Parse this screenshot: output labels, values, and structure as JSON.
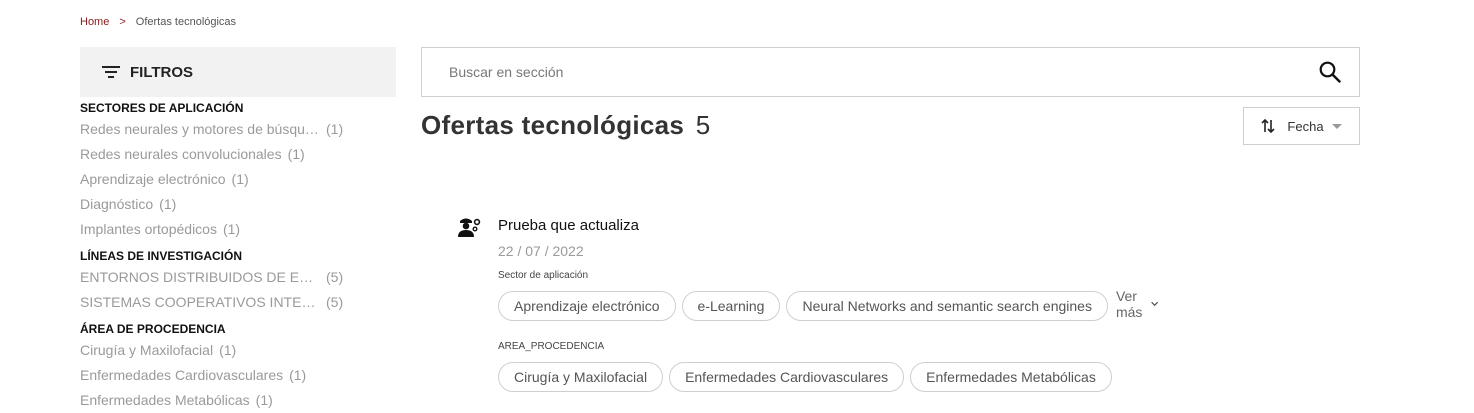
{
  "breadcrumb": {
    "home": "Home",
    "separator": ">",
    "current": "Ofertas tecnológicas"
  },
  "filters": {
    "title": "FILTROS",
    "icon": "filter-icon",
    "sections": [
      {
        "heading": "SECTORES DE APLICACIÓN",
        "items": [
          {
            "label": "Redes neurales y motores de búsqueda semántica",
            "count": "(1)"
          },
          {
            "label": "Redes neurales convolucionales",
            "count": "(1)"
          },
          {
            "label": "Aprendizaje electrónico",
            "count": "(1)"
          },
          {
            "label": "Diagnóstico",
            "count": "(1)"
          },
          {
            "label": "Implantes ortopédicos",
            "count": "(1)"
          }
        ]
      },
      {
        "heading": "LÍNEAS DE INVESTIGACIÓN",
        "items": [
          {
            "label": "ENTORNOS DISTRIBUIDOS DE ENSEÑANZA",
            "count": "(5)"
          },
          {
            "label": "SISTEMAS COOPERATIVOS INTELIGENTES",
            "count": "(5)"
          }
        ]
      },
      {
        "heading": "ÁREA DE PROCEDENCIA",
        "items": [
          {
            "label": "Cirugía y Maxilofacial",
            "count": "(1)"
          },
          {
            "label": "Enfermedades Cardiovasculares",
            "count": "(1)"
          },
          {
            "label": "Enfermedades Metabólicas",
            "count": "(1)"
          }
        ]
      }
    ]
  },
  "search": {
    "placeholder": "Buscar en sección",
    "value": ""
  },
  "page": {
    "title": "Ofertas tecnológicas",
    "count": "5"
  },
  "sort": {
    "label": "Fecha"
  },
  "result": {
    "title": "Prueba que actualiza",
    "date": "22 / 07 / 2022",
    "sector_label": "Sector de aplicación",
    "sector_chips": [
      "Aprendizaje electrónico",
      "e-Learning",
      "Neural Networks and semantic search engines"
    ],
    "ver_mas": "Ver más",
    "area_label": "AREA_PROCEDENCIA",
    "area_chips": [
      "Cirugía y Maxilofacial",
      "Enfermedades Cardiovasculares",
      "Enfermedades Metabólicas"
    ]
  }
}
